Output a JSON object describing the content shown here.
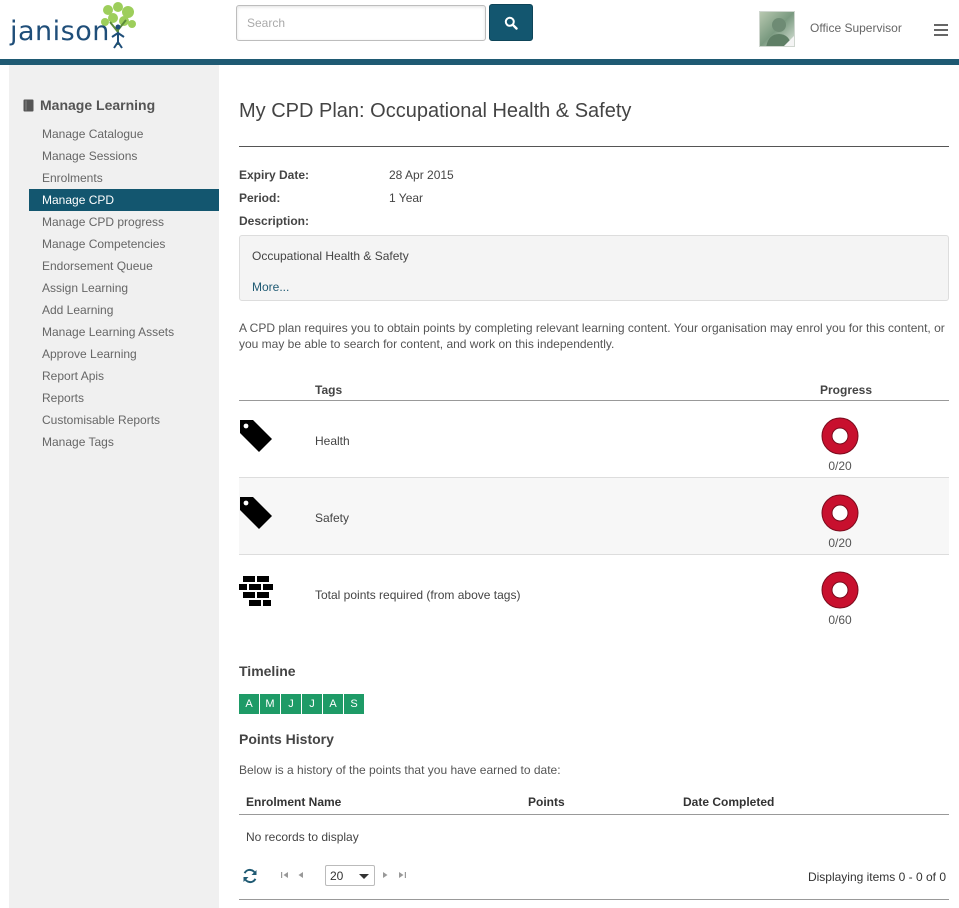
{
  "header": {
    "logo_text": "janison",
    "search": {
      "placeholder": "Search",
      "value": ""
    },
    "user_name": "Office Supervisor"
  },
  "sidebar": {
    "title": "Manage Learning",
    "items": [
      {
        "label": "Manage Catalogue"
      },
      {
        "label": "Manage Sessions"
      },
      {
        "label": "Enrolments"
      },
      {
        "label": "Manage CPD",
        "active": true
      },
      {
        "label": "Manage CPD progress"
      },
      {
        "label": "Manage Competencies"
      },
      {
        "label": "Endorsement Queue"
      },
      {
        "label": "Assign Learning"
      },
      {
        "label": "Add Learning"
      },
      {
        "label": "Manage Learning Assets"
      },
      {
        "label": "Approve Learning"
      },
      {
        "label": "Report Apis"
      },
      {
        "label": "Reports"
      },
      {
        "label": "Customisable Reports"
      },
      {
        "label": "Manage Tags"
      }
    ]
  },
  "main": {
    "title": "My CPD Plan: Occupational Health & Safety",
    "fields": {
      "expiry_label": "Expiry Date:",
      "expiry_value": "28 Apr 2015",
      "period_label": "Period:",
      "period_value": "1 Year",
      "description_label": "Description:"
    },
    "description": {
      "text": "Occupational Health & Safety",
      "more_link": "More..."
    },
    "intro": "A CPD plan requires you to obtain points by completing relevant learning content. Your organisation may enrol you for this content, or you may be able to search for content, and work on this independently.",
    "tags_table": {
      "headers": {
        "tags": "Tags",
        "progress": "Progress"
      },
      "rows": [
        {
          "icon": "tag-icon",
          "label": "Health",
          "progress": "0/20",
          "fraction": 0
        },
        {
          "icon": "tag-icon",
          "label": "Safety",
          "progress": "0/20",
          "fraction": 0
        },
        {
          "icon": "bricks-icon",
          "label": "Total points required (from above tags)",
          "progress": "0/60",
          "fraction": 0
        }
      ]
    },
    "timeline": {
      "title": "Timeline",
      "months": [
        "A",
        "M",
        "J",
        "J",
        "A",
        "S"
      ]
    },
    "points_history": {
      "title": "Points History",
      "description": "Below is a history of the points that you have earned to date:",
      "headers": {
        "name": "Enrolment Name",
        "points": "Points",
        "date": "Date Completed"
      },
      "empty": "No records to display",
      "page_size": "20",
      "summary": "Displaying items 0 - 0 of 0"
    }
  },
  "colors": {
    "brand": "#13566f",
    "progress_red": "#c8102e",
    "timeline_green": "#1e9b67"
  }
}
